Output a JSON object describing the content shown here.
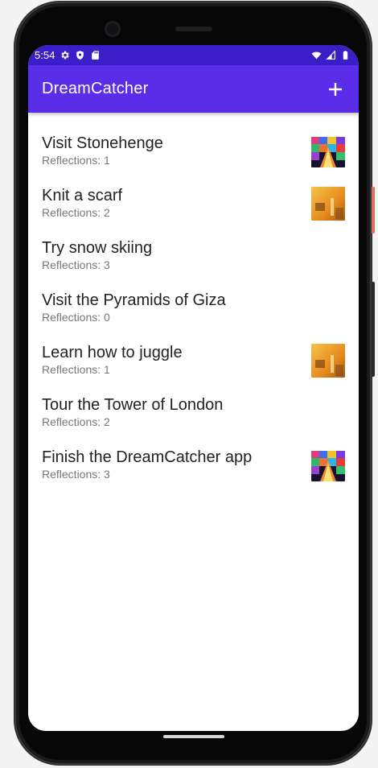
{
  "status_bar": {
    "time": "5:54",
    "icons": [
      "gear-icon",
      "shield-icon",
      "sd-card-icon",
      "wifi-icon",
      "signal-icon",
      "battery-icon"
    ]
  },
  "app_bar": {
    "title": "DreamCatcher",
    "add_icon": "plus-icon"
  },
  "dreams": [
    {
      "title": "Visit Stonehenge",
      "reflections": "Reflections: 1",
      "thumbnail": "colorful-disco"
    },
    {
      "title": "Knit a scarf",
      "reflections": "Reflections: 2",
      "thumbnail": "warm-room"
    },
    {
      "title": "Try snow skiing",
      "reflections": "Reflections: 3",
      "thumbnail": ""
    },
    {
      "title": "Visit the Pyramids of Giza",
      "reflections": "Reflections: 0",
      "thumbnail": ""
    },
    {
      "title": "Learn how to juggle",
      "reflections": "Reflections: 1",
      "thumbnail": "warm-room"
    },
    {
      "title": "Tour the Tower of London",
      "reflections": "Reflections: 2",
      "thumbnail": ""
    },
    {
      "title": "Finish the DreamCatcher app",
      "reflections": "Reflections: 3",
      "thumbnail": "colorful-disco"
    }
  ],
  "colors": {
    "status_bar": "#3c1ec8",
    "app_bar": "#5a2ee8",
    "background": "#ffffff"
  }
}
